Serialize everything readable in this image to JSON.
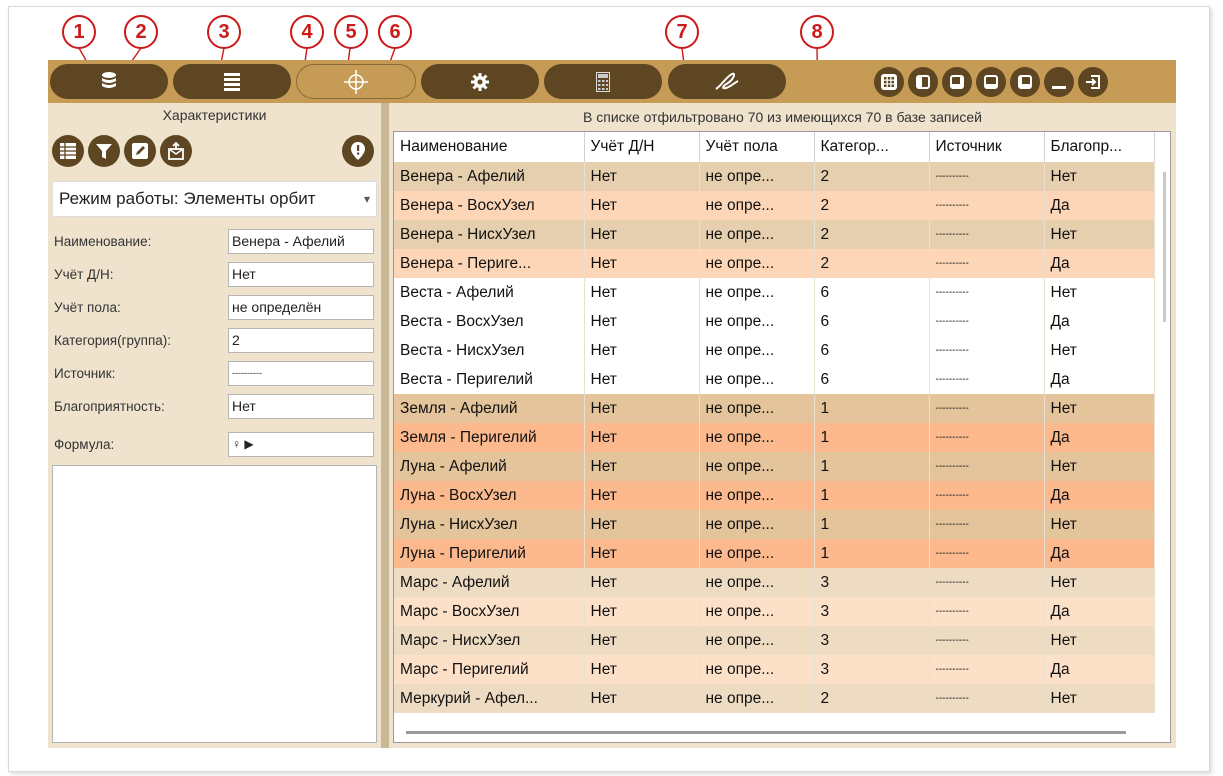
{
  "callouts": [
    "1",
    "2",
    "3",
    "4",
    "5",
    "6",
    "7",
    "8"
  ],
  "toolbar": {
    "buttons": [
      "database-icon",
      "list-icon",
      "crosshair-icon",
      "gear-icon",
      "calculator-icon",
      "signature-icon"
    ],
    "layout_buttons": [
      "grid-layout-icon",
      "layout-left-icon",
      "layout-bottom-icon",
      "layout-right-icon",
      "layout-top-icon",
      "minimize-icon",
      "exit-icon"
    ],
    "accent": "#c69b55",
    "button_color": "#5e4622"
  },
  "left_panel": {
    "title": "Характеристики",
    "icon_buttons": [
      "table-icon",
      "filter-icon",
      "edit-icon",
      "export-icon",
      "info-icon"
    ],
    "mode_select": "Режим работы: Элементы орбит",
    "fields": [
      {
        "label": "Наименование:",
        "value": "Венера - Афелий"
      },
      {
        "label": "Учёт Д/Н:",
        "value": "Нет"
      },
      {
        "label": "Учёт пола:",
        "value": "не определён"
      },
      {
        "label": "Категория(группа):",
        "value": "2"
      },
      {
        "label": "Источник:",
        "value": "----------"
      },
      {
        "label": "Благоприятность:",
        "value": "Нет"
      },
      {
        "label": "Формула:",
        "value": "♀ ▶"
      }
    ]
  },
  "right_panel": {
    "filter_text": "В списке отфильтровано 70 из имеющихся 70 в базе записей",
    "columns": [
      "Наименование",
      "Учёт Д/Н",
      "Учёт пола",
      "Категор...",
      "Источник",
      "Благопр..."
    ],
    "rows": [
      [
        "Венера - Афелий",
        "Нет",
        "не опре...",
        "2",
        "----------",
        "Нет"
      ],
      [
        "Венера - ВосхУзел",
        "Нет",
        "не опре...",
        "2",
        "----------",
        "Да"
      ],
      [
        "Венера - НисхУзел",
        "Нет",
        "не опре...",
        "2",
        "----------",
        "Нет"
      ],
      [
        "Венера - Периге...",
        "Нет",
        "не опре...",
        "2",
        "----------",
        "Да"
      ],
      [
        "Веста - Афелий",
        "Нет",
        "не опре...",
        "6",
        "----------",
        "Нет"
      ],
      [
        "Веста - ВосхУзел",
        "Нет",
        "не опре...",
        "6",
        "----------",
        "Да"
      ],
      [
        "Веста - НисхУзел",
        "Нет",
        "не опре...",
        "6",
        "----------",
        "Нет"
      ],
      [
        "Веста - Перигелий",
        "Нет",
        "не опре...",
        "6",
        "----------",
        "Да"
      ],
      [
        "Земля - Афелий",
        "Нет",
        "не опре...",
        "1",
        "----------",
        "Нет"
      ],
      [
        "Земля - Перигелий",
        "Нет",
        "не опре...",
        "1",
        "----------",
        "Да"
      ],
      [
        "Луна - Афелий",
        "Нет",
        "не опре...",
        "1",
        "----------",
        "Нет"
      ],
      [
        "Луна - ВосхУзел",
        "Нет",
        "не опре...",
        "1",
        "----------",
        "Да"
      ],
      [
        "Луна - НисхУзел",
        "Нет",
        "не опре...",
        "1",
        "----------",
        "Нет"
      ],
      [
        "Луна - Перигелий",
        "Нет",
        "не опре...",
        "1",
        "----------",
        "Да"
      ],
      [
        "Марс - Афелий",
        "Нет",
        "не опре...",
        "3",
        "----------",
        "Нет"
      ],
      [
        "Марс - ВосхУзел",
        "Нет",
        "не опре...",
        "3",
        "----------",
        "Да"
      ],
      [
        "Марс - НисхУзел",
        "Нет",
        "не опре...",
        "3",
        "----------",
        "Нет"
      ],
      [
        "Марс - Перигелий",
        "Нет",
        "не опре...",
        "3",
        "----------",
        "Да"
      ],
      [
        "Меркурий - Афел...",
        "Нет",
        "не опре...",
        "2",
        "----------",
        "Нет"
      ]
    ],
    "row_colors": [
      "#e5cfae",
      "#fcd6b6",
      "#e5cfae",
      "#fcd6b6",
      "#ffffff",
      "#ffffff",
      "#ffffff",
      "#ffffff",
      "#e3c49b",
      "#fbb98d",
      "#e3c49b",
      "#fbb98d",
      "#e3c49b",
      "#fbb98d",
      "#eedcc2",
      "#fde0c8",
      "#eedcc2",
      "#fde0c8",
      "#eedcc2"
    ]
  }
}
